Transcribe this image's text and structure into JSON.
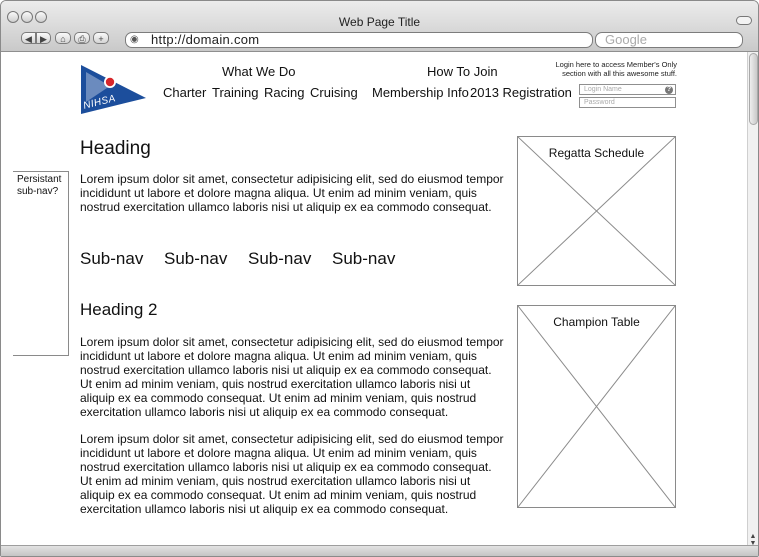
{
  "browser": {
    "window_title": "Web Page Title",
    "url": "http://domain.com",
    "search_placeholder": "Google",
    "nav_buttons": {
      "back": "◀",
      "forward": "▶",
      "home": "⌂",
      "print": "⎙",
      "add": "+",
      "rss": "◉"
    }
  },
  "header": {
    "logo_text": "NIHSA",
    "nav_groups": [
      {
        "label": "What We Do",
        "items": [
          "Charter",
          "Training",
          "Racing",
          "Cruising"
        ]
      },
      {
        "label": "How To Join",
        "items": [
          "Membership Info",
          "2013 Registration"
        ]
      }
    ],
    "login": {
      "note_line1": "Login here to access Member's Only",
      "note_line2": "section with all this awesome stuff.",
      "name_placeholder": "Login Name",
      "password_placeholder": "Password",
      "help_icon": "?"
    }
  },
  "sidebar": {
    "note": "Persistant sub-nav?"
  },
  "main": {
    "heading1": "Heading",
    "para1": "Lorem ipsum dolor sit amet, consectetur adipisicing elit, sed do eiusmod tempor incididunt ut labore et dolore magna aliqua. Ut enim ad minim veniam, quis nostrud exercitation ullamco laboris nisi ut aliquip ex ea commodo consequat.",
    "subnav": [
      "Sub-nav",
      "Sub-nav",
      "Sub-nav",
      "Sub-nav"
    ],
    "heading2": "Heading 2",
    "para2": "Lorem ipsum dolor sit amet, consectetur adipisicing elit, sed do eiusmod tempor incididunt ut labore et dolore magna aliqua. Ut enim ad minim veniam, quis nostrud exercitation ullamco laboris nisi ut aliquip ex ea commodo consequat. Ut enim ad minim veniam, quis nostrud exercitation ullamco laboris nisi ut aliquip ex ea commodo consequat. Ut enim ad minim veniam, quis nostrud exercitation ullamco laboris nisi ut aliquip ex ea commodo consequat.",
    "para3": "Lorem ipsum dolor sit amet, consectetur adipisicing elit, sed do eiusmod tempor incididunt ut labore et dolore magna aliqua. Ut enim ad minim veniam, quis nostrud exercitation ullamco laboris nisi ut aliquip ex ea commodo consequat. Ut enim ad minim veniam, quis nostrud exercitation ullamco laboris nisi ut aliquip ex ea commodo consequat. Ut enim ad minim veniam, quis nostrud exercitation ullamco laboris nisi ut aliquip ex ea commodo consequat."
  },
  "right_column": {
    "box1_label": "Regatta Schedule",
    "box2_label": "Champion Table"
  },
  "colors": {
    "logo_blue": "#1c4e9c",
    "logo_red": "#d7262a",
    "border": "#8a8a8a"
  }
}
